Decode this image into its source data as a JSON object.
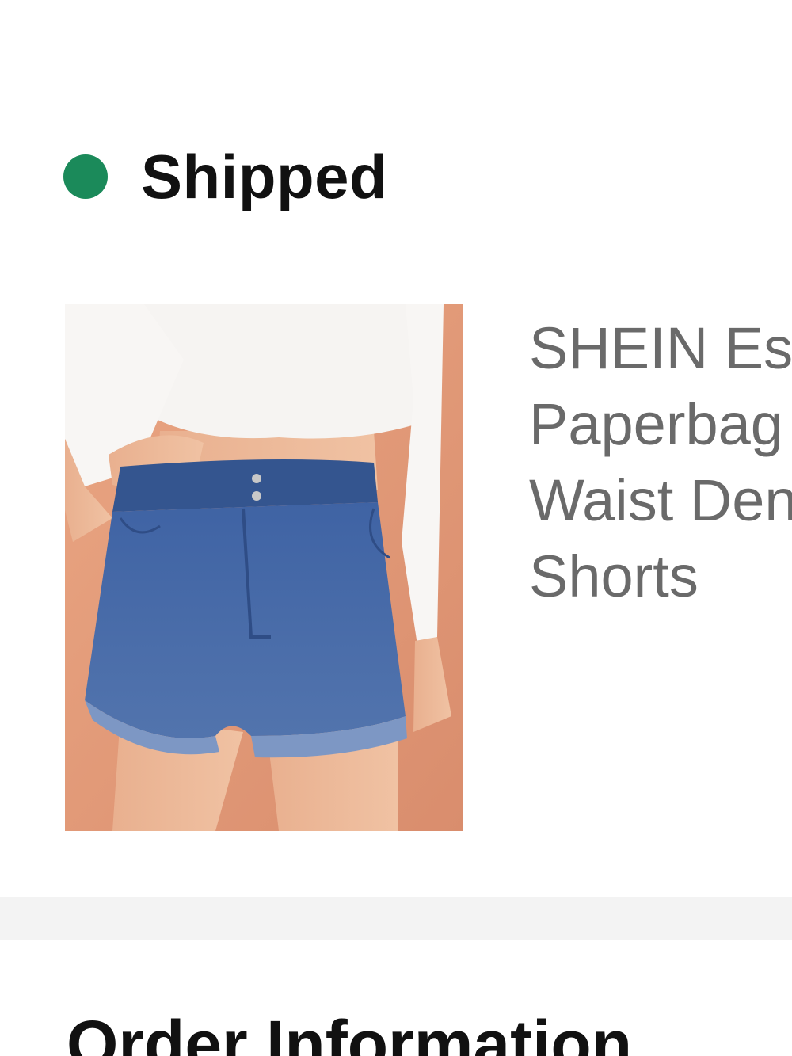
{
  "order": {
    "status_label": "Shipped",
    "status_color": "#1b8a5a"
  },
  "product": {
    "title": "SHEIN Essnce Paperbag Waist Denim Shorts",
    "image_alt": "Denim shorts product photo"
  },
  "sections": {
    "order_information_heading": "Order Information"
  },
  "icons": {
    "status_indicator": "status-dot-icon"
  }
}
